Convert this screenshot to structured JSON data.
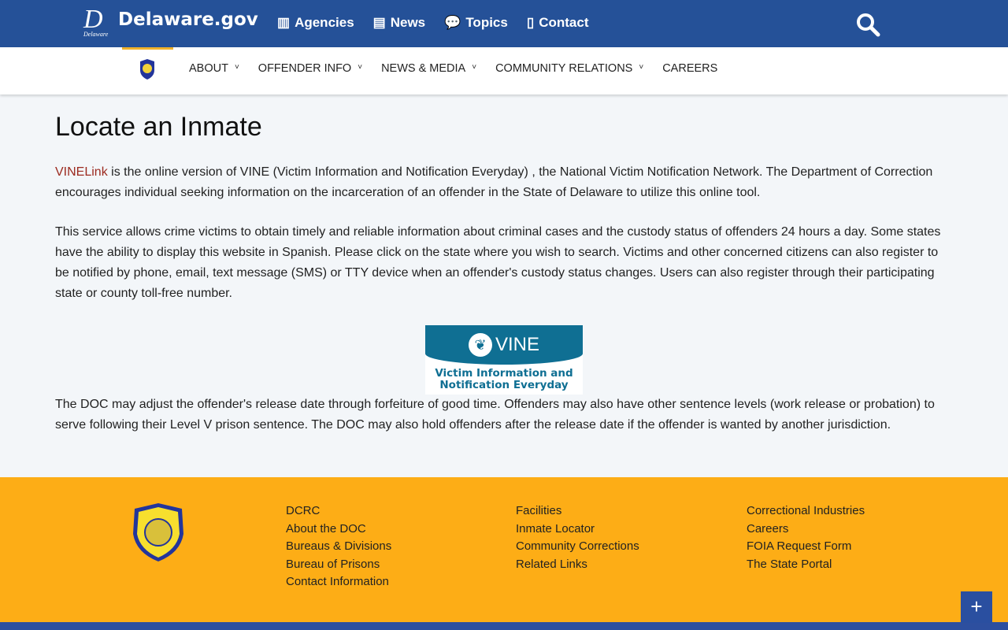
{
  "header": {
    "logo_letter": "D",
    "logo_sub": "Delaware",
    "site": "Delaware.gov",
    "nav": [
      {
        "label": "Agencies",
        "icon": "building-icon"
      },
      {
        "label": "News",
        "icon": "newspaper-icon"
      },
      {
        "label": "Topics",
        "icon": "chat-icon"
      },
      {
        "label": "Contact",
        "icon": "mobile-icon"
      }
    ]
  },
  "subnav": [
    {
      "label": "ABOUT",
      "dropdown": true
    },
    {
      "label": "OFFENDER INFO",
      "dropdown": true
    },
    {
      "label": "NEWS & MEDIA",
      "dropdown": true
    },
    {
      "label": "COMMUNITY RELATIONS",
      "dropdown": true
    },
    {
      "label": "CAREERS",
      "dropdown": false
    }
  ],
  "main": {
    "title": "Locate an Inmate",
    "p1_link": "VINELink",
    "p1_rest": " is the online version of VINE (Victim Information and Notification Everyday) , the National Victim Notification Network. The Department of Correction encourages individual seeking information on the incarceration of an offender in the State of Delaware to utilize this online tool.",
    "p2": "This service allows crime victims to obtain timely and reliable information about criminal cases and the custody status of offenders 24 hours a day. Some states have the ability to display this website in Spanish. Please click on the state where you wish to search. Victims and other concerned citizens can also register to be notified by phone, email, text message (SMS) or TTY device when an offender's custody status changes. Users can also register through their participating state or county toll-free number.",
    "vine": {
      "name": "VINE",
      "tagline1": "Victim Information and",
      "tagline2": "Notification Everyday"
    },
    "p3": "The DOC may adjust the offender's release date through forfeiture of good time. Offenders may also have other sentence levels (work release or probation) to serve following their Level V prison sentence. The DOC may also hold offenders after the release date if the offender is wanted by another jurisdiction."
  },
  "footer": {
    "columns": [
      [
        "DCRC",
        "About the DOC",
        "Bureaus & Divisions",
        "Bureau of Prisons",
        "Contact Information"
      ],
      [
        "Facilities",
        "Inmate Locator",
        "Community Corrections",
        "Related Links"
      ],
      [
        "Correctional Industries",
        "Careers",
        "FOIA Request Form",
        "The State Portal"
      ]
    ],
    "plus": "+"
  },
  "colors": {
    "header": "#255198",
    "footer": "#fdad16",
    "link": "#9c2a1f",
    "vine": "#0f6f93"
  }
}
